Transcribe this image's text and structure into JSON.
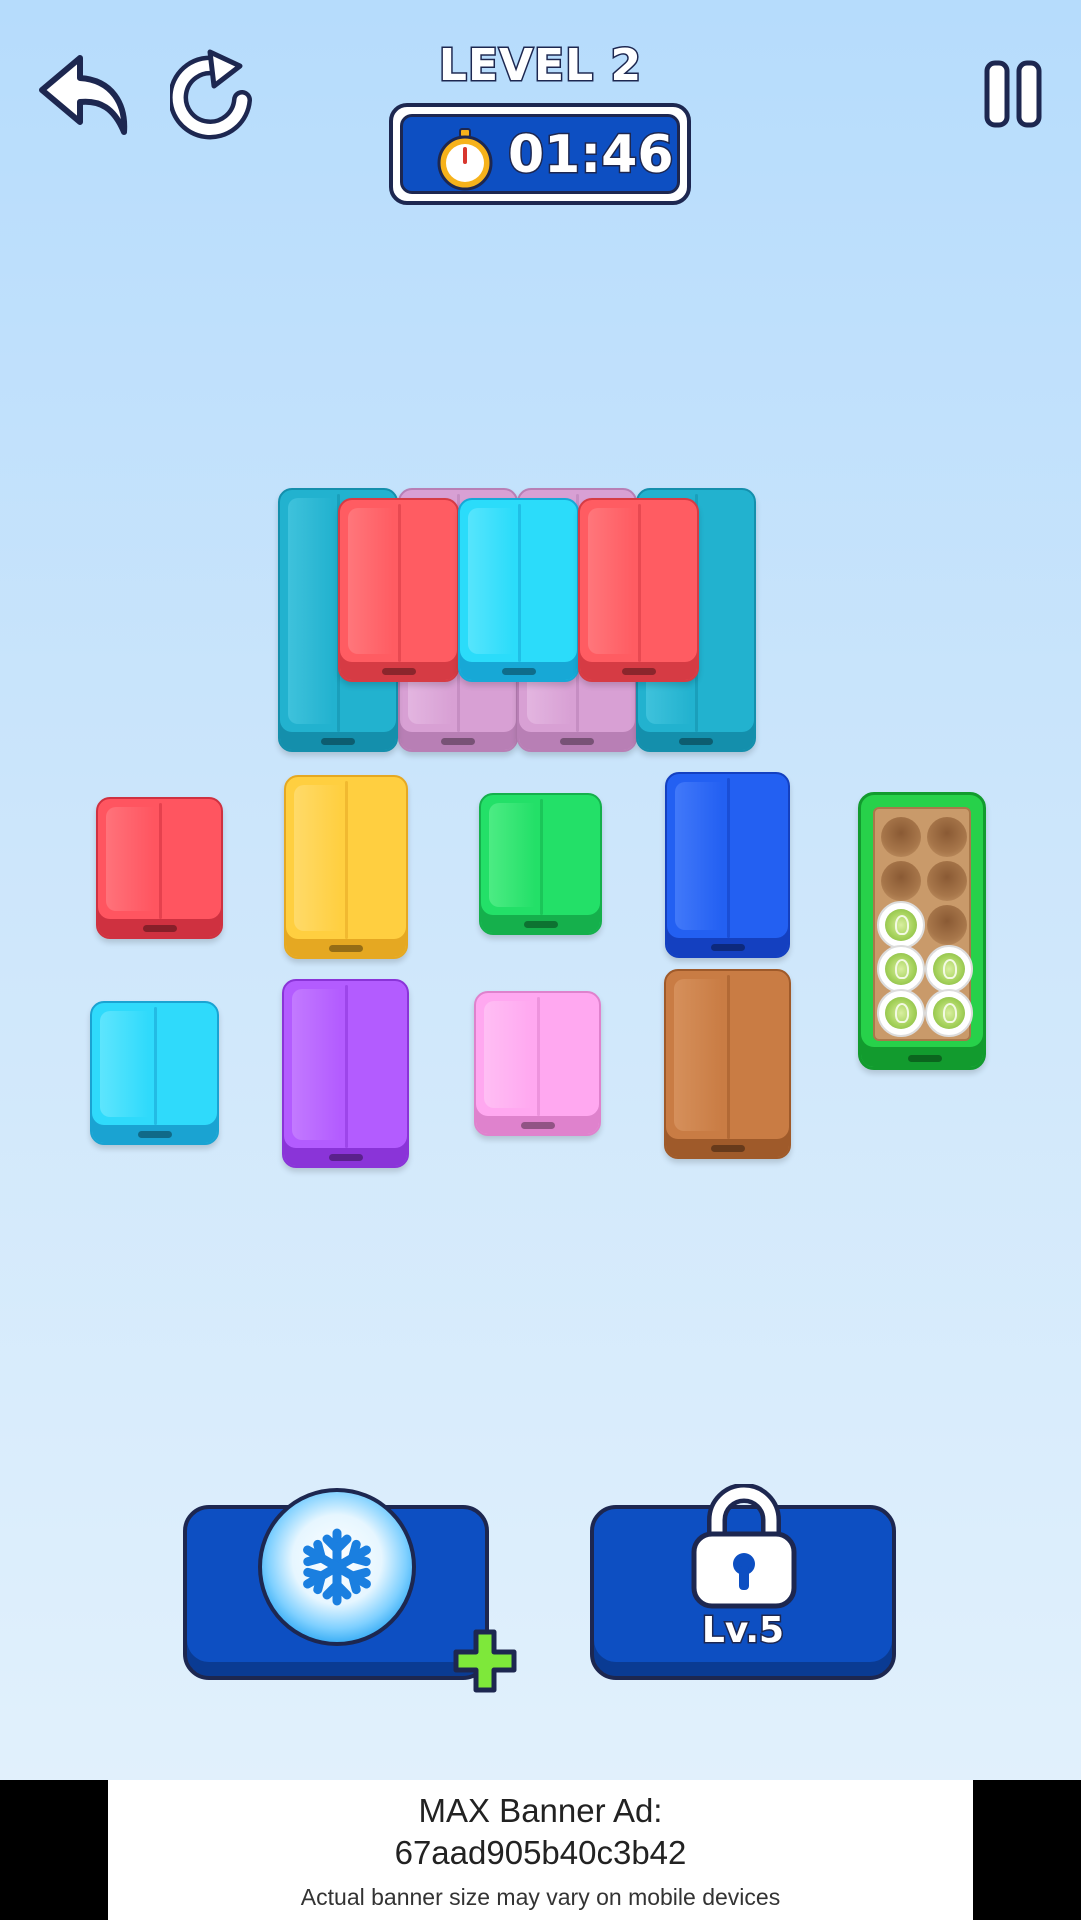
{
  "header": {
    "level_title": "LEVEL 2",
    "timer": "01:46",
    "icons": [
      "undo-icon",
      "restart-icon",
      "stopwatch-icon",
      "pause-icon"
    ]
  },
  "board": {
    "colors": {
      "teal": "#22b2cf",
      "red": "#ff5c62",
      "cyan": "#2bdcfa",
      "pink_back": "#d8a0d4",
      "red_box": "#ff5560",
      "yellow": "#ffcf40",
      "green": "#23e068",
      "blue": "#2360f2",
      "light_blue": "#2fdafb",
      "purple": "#b35cff",
      "pink": "#ffa8f0",
      "brown": "#c97c44",
      "tray_green": "#27d14a"
    },
    "cup_tray": {
      "filled_cups": 5,
      "total_slots": 10
    }
  },
  "boosters": {
    "freeze": {
      "icon": "snowflake-icon",
      "badge": "plus-icon"
    },
    "locked": {
      "label": "Lv.5",
      "icon": "lock-icon"
    }
  },
  "ad": {
    "line1": "MAX Banner Ad:",
    "line2": "67aad905b40c3b42",
    "line3": "Actual banner size may vary on mobile devices"
  }
}
